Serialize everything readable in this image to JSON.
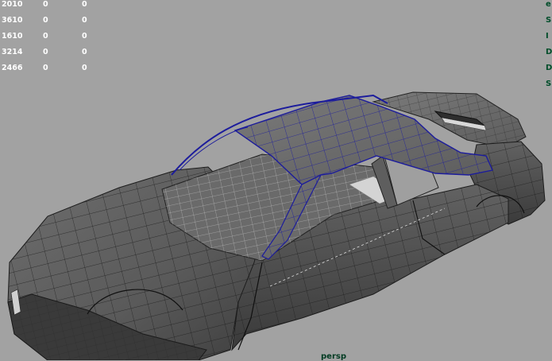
{
  "hud": {
    "rows": [
      {
        "a": "2010",
        "b": "0",
        "c": "0"
      },
      {
        "a": "3610",
        "b": "0",
        "c": "0"
      },
      {
        "a": "1610",
        "b": "0",
        "c": "0"
      },
      {
        "a": "3214",
        "b": "0",
        "c": "0"
      },
      {
        "a": "2466",
        "b": "0",
        "c": "0"
      }
    ],
    "right_labels": [
      "e",
      "S",
      "I",
      "D",
      "D",
      "S"
    ]
  },
  "viewport": {
    "camera": "persp",
    "background_color": "#a2a2a2",
    "mesh_color": "#5c5c5c",
    "selection_color": "#1c1c9c"
  }
}
